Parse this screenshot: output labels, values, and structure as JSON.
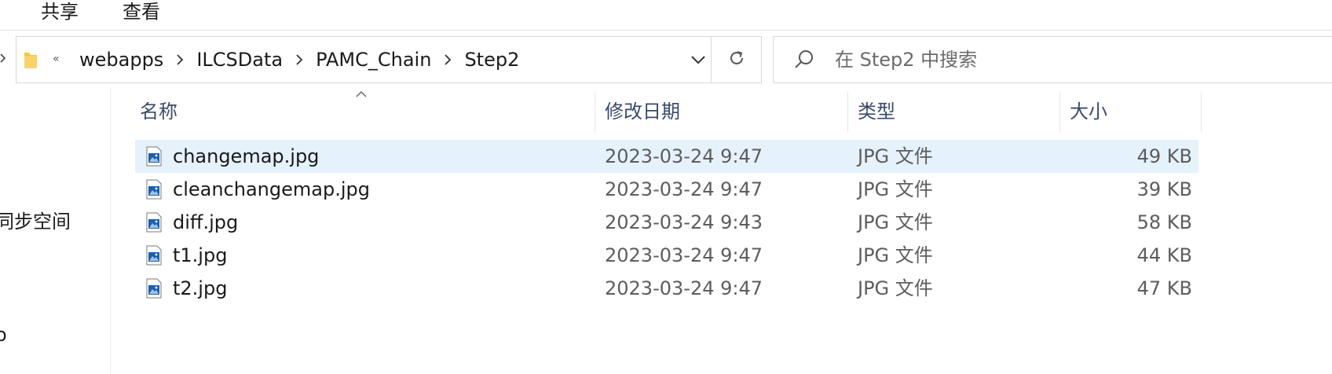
{
  "ribbon": {
    "tabs": [
      "共享",
      "查看"
    ]
  },
  "address": {
    "overflow": "«",
    "crumbs": [
      "webapps",
      "ILCSData",
      "PAMC_Chain",
      "Step2"
    ]
  },
  "search": {
    "placeholder": "在 Step2 中搜索"
  },
  "nav_pane": {
    "items": [
      "同步空间",
      "o"
    ]
  },
  "columns": {
    "name": "名称",
    "date": "修改日期",
    "type": "类型",
    "size": "大小"
  },
  "files": [
    {
      "name": "changemap.jpg",
      "date": "2023-03-24 9:47",
      "type": "JPG 文件",
      "size": "49 KB",
      "selected": true
    },
    {
      "name": "cleanchangemap.jpg",
      "date": "2023-03-24 9:47",
      "type": "JPG 文件",
      "size": "39 KB",
      "selected": false
    },
    {
      "name": "diff.jpg",
      "date": "2023-03-24 9:43",
      "type": "JPG 文件",
      "size": "58 KB",
      "selected": false
    },
    {
      "name": "t1.jpg",
      "date": "2023-03-24 9:47",
      "type": "JPG 文件",
      "size": "44 KB",
      "selected": false
    },
    {
      "name": "t2.jpg",
      "date": "2023-03-24 9:47",
      "type": "JPG 文件",
      "size": "47 KB",
      "selected": false
    }
  ],
  "icons": {
    "folder": "folder-icon",
    "breadcrumb_separator": "chevron-right-icon",
    "dropdown": "chevron-down-icon",
    "refresh": "refresh-icon",
    "search": "search-icon",
    "sort": "sort-ascending-icon",
    "file": "jpg-image-file-icon"
  },
  "colors": {
    "selection": "#e5f1fb",
    "folder": "#f4c542",
    "file_icon_blue": "#1e5fa8"
  }
}
